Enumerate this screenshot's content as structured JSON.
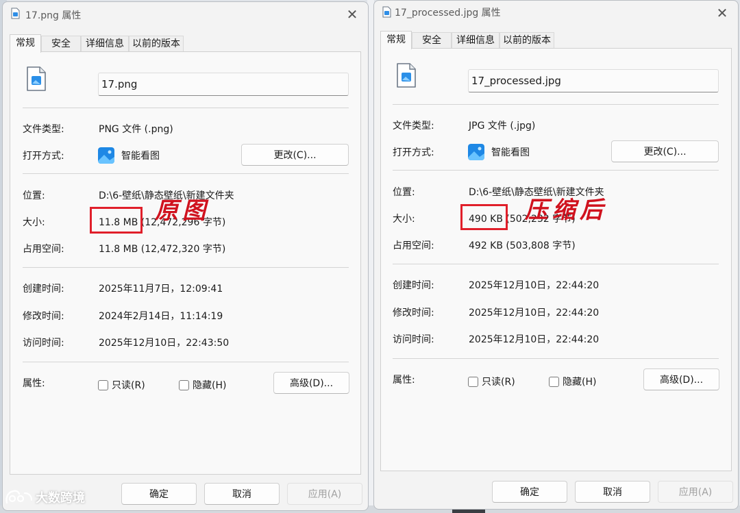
{
  "left_dialog": {
    "title": "17.png 属性",
    "tabs": [
      "常规",
      "安全",
      "详细信息",
      "以前的版本"
    ],
    "filename": "17.png",
    "file_type_label": "文件类型:",
    "file_type_value": "PNG 文件 (.png)",
    "open_with_label": "打开方式:",
    "open_with_app": "智能看图",
    "change_button": "更改(C)...",
    "location_label": "位置:",
    "location_value": "D:\\6-壁纸\\静态壁纸\\新建文件夹",
    "size_label": "大小:",
    "size_value": "11.8 MB (12,472,296 字节)",
    "disk_size_label": "占用空间:",
    "disk_size_value": "11.8 MB (12,472,320 字节)",
    "created_label": "创建时间:",
    "created_value": "2025年11月7日，12:09:41",
    "modified_label": "修改时间:",
    "modified_value": "2024年2月14日，11:14:19",
    "accessed_label": "访问时间:",
    "accessed_value": "2025年12月10日，22:43:50",
    "attributes_label": "属性:",
    "readonly_label": "只读(R)",
    "hidden_label": "隐藏(H)",
    "advanced_button": "高级(D)...",
    "ok_button": "确定",
    "cancel_button": "取消",
    "apply_button": "应用(A)"
  },
  "right_dialog": {
    "title": "17_processed.jpg 属性",
    "tabs": [
      "常规",
      "安全",
      "详细信息",
      "以前的版本"
    ],
    "filename": "17_processed.jpg",
    "file_type_label": "文件类型:",
    "file_type_value": "JPG 文件 (.jpg)",
    "open_with_label": "打开方式:",
    "open_with_app": "智能看图",
    "change_button": "更改(C)...",
    "location_label": "位置:",
    "location_value": "D:\\6-壁纸\\静态壁纸\\新建文件夹",
    "size_label": "大小:",
    "size_value": "490 KB (502,232 字节)",
    "disk_size_label": "占用空间:",
    "disk_size_value": "492 KB (503,808 字节)",
    "created_label": "创建时间:",
    "created_value": "2025年12月10日，22:44:20",
    "modified_label": "修改时间:",
    "modified_value": "2025年12月10日，22:44:20",
    "accessed_label": "访问时间:",
    "accessed_value": "2025年12月10日，22:44:20",
    "attributes_label": "属性:",
    "readonly_label": "只读(R)",
    "hidden_label": "隐藏(H)",
    "advanced_button": "高级(D)...",
    "ok_button": "确定",
    "cancel_button": "取消",
    "apply_button": "应用(A)"
  },
  "annotations": {
    "original_label": "原图",
    "compressed_label": "压缩后",
    "highlight_color": "#e01f2a"
  },
  "watermark": {
    "text": "大数跨境"
  },
  "icons": {
    "file": "image-file-icon",
    "app": "photo-viewer-icon",
    "close": "close-icon",
    "brand": "dashuju-logo-icon"
  }
}
